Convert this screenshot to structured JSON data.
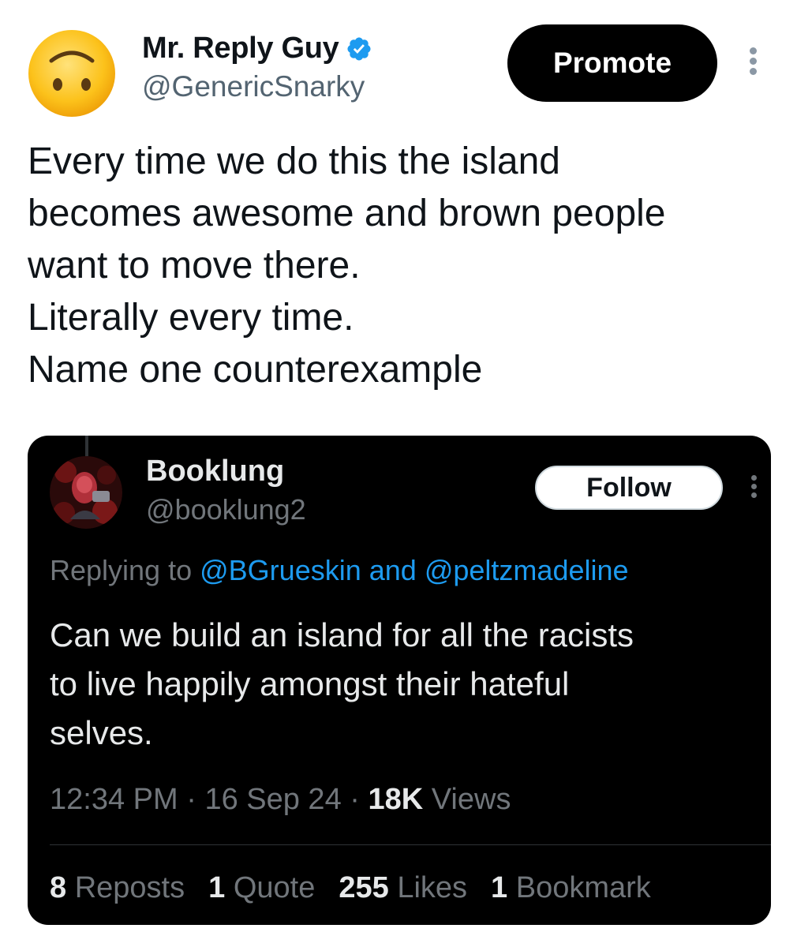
{
  "post": {
    "author_name": "Mr. Reply Guy",
    "author_handle": "@GenericSnarky",
    "avatar_icon": "upside-down-face-emoji",
    "verified_icon": "verified-badge-icon",
    "promote_label": "Promote",
    "text_lines": [
      "Every time we do this the island",
      "becomes awesome and brown people",
      "want to move there.",
      "Literally every time.",
      "Name one counterexample"
    ]
  },
  "quoted": {
    "author_name": "Booklung",
    "author_handle": "@booklung2",
    "follow_label": "Follow",
    "replying_prefix": "Replying to",
    "mention_1": "@BGrueskin",
    "replying_and": "and",
    "mention_2": "@peltzmadeline",
    "text_lines": [
      "Can we build an island for all the racists",
      "to live happily amongst their hateful",
      "selves."
    ],
    "time": "12:34 PM",
    "date": "16 Sep 24",
    "views_count": "18K",
    "views_label": "Views",
    "separator": "·",
    "stats": {
      "reposts_count": "8",
      "reposts_label": "Reposts",
      "quote_count": "1",
      "quote_label": "Quote",
      "likes_count": "255",
      "likes_label": "Likes",
      "bookmark_count": "1",
      "bookmark_label": "Bookmark"
    }
  },
  "colors": {
    "verified_blue": "#1d9bf0",
    "mention_blue": "#1d9bf0",
    "emoji_yellow": "#fcbf1e"
  }
}
